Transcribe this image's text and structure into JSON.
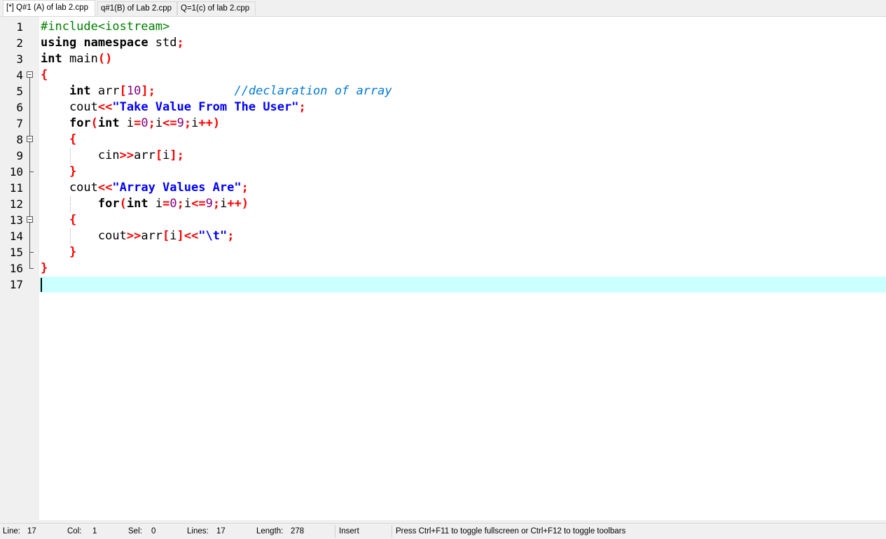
{
  "tabs": [
    {
      "label": "[*] Q#1 (A) of lab 2.cpp",
      "active": true
    },
    {
      "label": "q#1(B) of Lab 2.cpp",
      "active": false
    },
    {
      "label": "Q=1(c) of lab 2.cpp",
      "active": false
    }
  ],
  "editor": {
    "line_numbers": [
      "1",
      "2",
      "3",
      "4",
      "5",
      "6",
      "7",
      "8",
      "9",
      "10",
      "11",
      "12",
      "13",
      "14",
      "15",
      "16",
      "17"
    ],
    "lines": [
      "#include<iostream>",
      "using namespace std;",
      "int main()",
      "{",
      "    int arr[10];           //declaration of array",
      "    cout<<\"Take Value From The User\";",
      "    for(int i=0;i<=9;i++)",
      "    {",
      "        cin>>arr[i];",
      "    }",
      "    cout<<\"Array Values Are\";",
      "        for(int i=0;i<=9;i++)",
      "    {",
      "        cout>>arr[i]<<\"\\t\";",
      "    }",
      "}",
      ""
    ],
    "current_line_color": "#ccffff"
  },
  "status": {
    "line_label": "Line:",
    "line_value": "17",
    "col_label": "Col:",
    "col_value": "1",
    "sel_label": "Sel:",
    "sel_value": "0",
    "lines_label": "Lines:",
    "lines_value": "17",
    "length_label": "Length:",
    "length_value": "278",
    "mode": "Insert",
    "hint": "Press Ctrl+F11 to toggle fullscreen or Ctrl+F12 to toggle toolbars"
  }
}
